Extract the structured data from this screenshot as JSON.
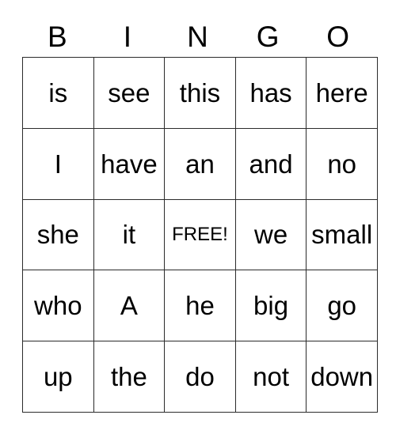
{
  "card": {
    "title_letters": [
      "B",
      "I",
      "N",
      "G",
      "O"
    ],
    "free_space": "FREE!",
    "colors": {
      "background": "#ffffff",
      "border": "#2b2b2b",
      "text": "#000000"
    },
    "rows": [
      [
        "is",
        "see",
        "this",
        "has",
        "here"
      ],
      [
        "I",
        "have",
        "an",
        "and",
        "no"
      ],
      [
        "she",
        "it",
        "FREE!",
        "we",
        "small"
      ],
      [
        "who",
        "A",
        "he",
        "big",
        "go"
      ],
      [
        "up",
        "the",
        "do",
        "not",
        "down"
      ]
    ]
  }
}
